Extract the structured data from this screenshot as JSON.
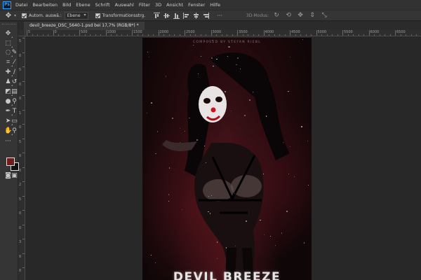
{
  "app": {
    "logo_text": "Ps",
    "menu": [
      "Datei",
      "Bearbeiten",
      "Bild",
      "Ebene",
      "Schrift",
      "Auswahl",
      "Filter",
      "3D",
      "Ansicht",
      "Fenster",
      "Hilfe"
    ]
  },
  "options_bar": {
    "auto_select_label": "Autom. auswä.:",
    "auto_select_target": "Ebene",
    "transform_label": "Transformationsstrg.",
    "mode_3d_label": "3D-Modus:"
  },
  "document": {
    "tab_title": "devil_breeze_DSC_5640-1.psd bei 17,7% (RGB/8*) *"
  },
  "rulers": {
    "top_labels": [
      "5",
      "0",
      "500",
      "1000",
      "1500",
      "2000",
      "2500",
      "3000",
      "3500",
      "4000",
      "4500",
      "5000",
      "5500",
      "6000",
      "6500",
      "7000",
      "7500"
    ],
    "left_labels": [
      "5",
      "0",
      "5",
      "0",
      "0",
      "1",
      "0",
      "5",
      "0",
      "0",
      "2",
      "5",
      "0",
      "0",
      "3",
      "0",
      "0"
    ]
  },
  "poster": {
    "credit": "COMPOSED BY STEFAN RIEBL",
    "title": "DEVIL BREEZE"
  },
  "colors": {
    "foreground": "#6e1b1b",
    "background": "#111111",
    "accent": "#2fa3f7"
  }
}
